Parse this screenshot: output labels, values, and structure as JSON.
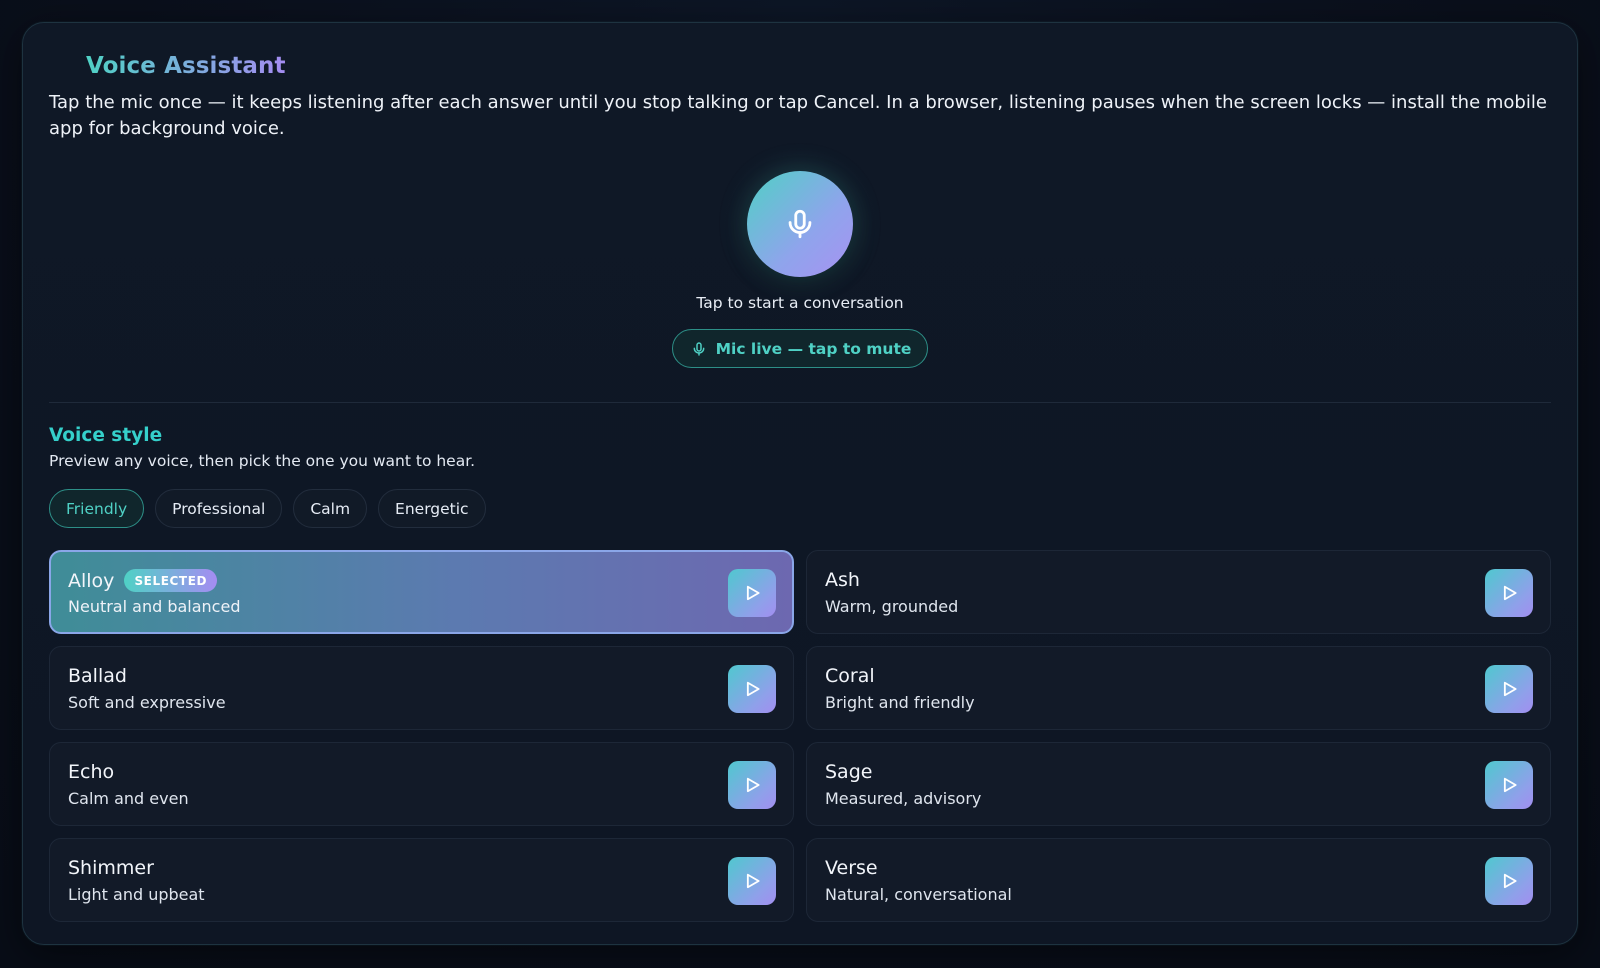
{
  "header": {
    "title": "Voice Assistant",
    "intro": "Tap the mic once — it keeps listening after each answer until you stop talking or tap Cancel. In a browser, listening pauses when the screen locks — install the mobile app for background voice."
  },
  "mic": {
    "icon": "microphone-icon",
    "caption": "Tap to start a conversation",
    "mute_label": "Mic live — tap to mute"
  },
  "voice_style": {
    "title": "Voice style",
    "subtitle": "Preview any voice, then pick the one you want to hear.",
    "chips": [
      {
        "label": "Friendly",
        "active": true
      },
      {
        "label": "Professional",
        "active": false
      },
      {
        "label": "Calm",
        "active": false
      },
      {
        "label": "Energetic",
        "active": false
      }
    ],
    "selected_badge": "SELECTED",
    "voices": [
      {
        "name": "Alloy",
        "desc": "Neutral and balanced",
        "selected": true
      },
      {
        "name": "Ash",
        "desc": "Warm, grounded",
        "selected": false
      },
      {
        "name": "Ballad",
        "desc": "Soft and expressive",
        "selected": false
      },
      {
        "name": "Coral",
        "desc": "Bright and friendly",
        "selected": false
      },
      {
        "name": "Echo",
        "desc": "Calm and even",
        "selected": false
      },
      {
        "name": "Sage",
        "desc": "Measured, advisory",
        "selected": false
      },
      {
        "name": "Shimmer",
        "desc": "Light and upbeat",
        "selected": false
      },
      {
        "name": "Verse",
        "desc": "Natural, conversational",
        "selected": false
      }
    ]
  },
  "colors": {
    "accent_teal": "#4fd1c5",
    "accent_violet": "#a58cf2",
    "background": "#0e1624"
  }
}
